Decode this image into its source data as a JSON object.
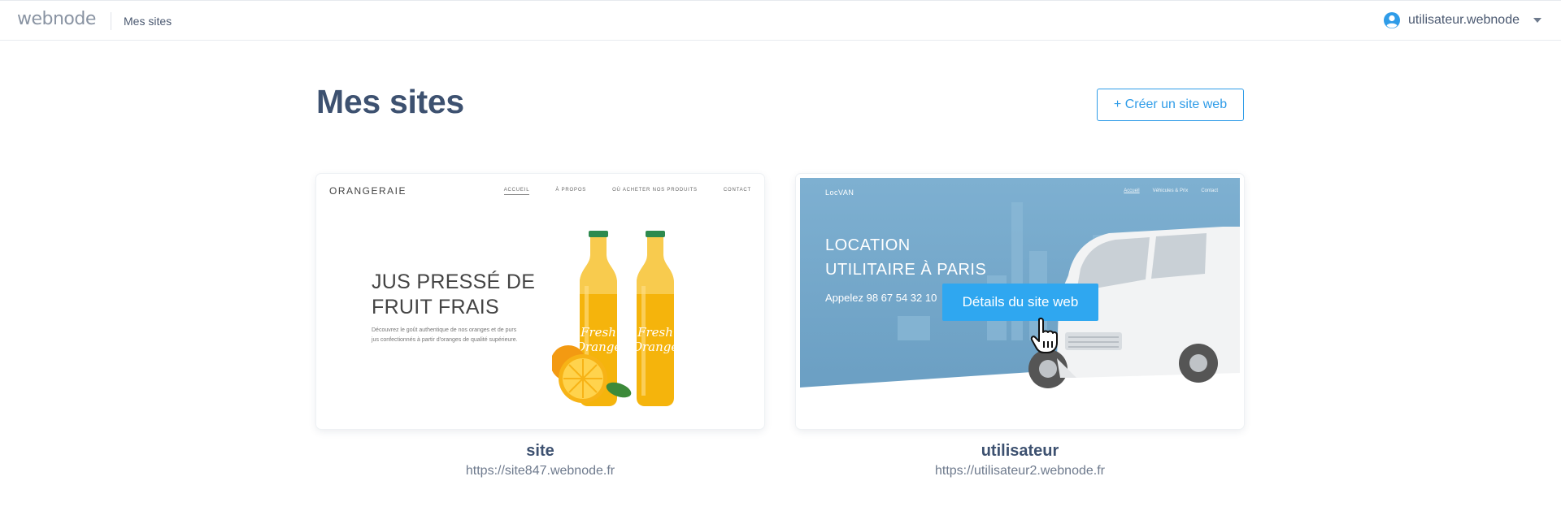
{
  "topbar": {
    "logo": "webnode",
    "nav_link": "Mes sites",
    "username": "utilisateur.webnode"
  },
  "header": {
    "title": "Mes sites",
    "create_button": "+ Créer un site web"
  },
  "sites": [
    {
      "name": "site",
      "url": "https://site847.webnode.fr",
      "preview": {
        "brand": "ORANGERAIE",
        "nav": [
          "ACCUEIL",
          "À PROPOS",
          "OÙ ACHETER NOS PRODUITS",
          "CONTACT"
        ],
        "headline_1": "JUS PRESSÉ DE",
        "headline_2": "FRUIT FRAIS",
        "sub_1": "Découvrez le goût authentique de nos oranges et de purs",
        "sub_2": "jus confectionnés à partir d'oranges de qualité supérieure.",
        "bottle_label_1": "Fresh",
        "bottle_label_2": "Orange"
      }
    },
    {
      "name": "utilisateur",
      "url": "https://utilisateur2.webnode.fr",
      "preview": {
        "brand": "LocVAN",
        "nav": [
          "Accueil",
          "Véhicules & Prix",
          "Contact"
        ],
        "headline_1": "LOCATION",
        "headline_2": "UTILITAIRE À PARIS",
        "phone": "Appelez 98 67 54 32 10"
      },
      "hover_button": "Détails du site web"
    }
  ],
  "colors": {
    "accent": "#2f9ce8",
    "title": "#3d5170",
    "hover_button": "#2fa7f0",
    "preview2_overlay": "#6fa3c6"
  }
}
